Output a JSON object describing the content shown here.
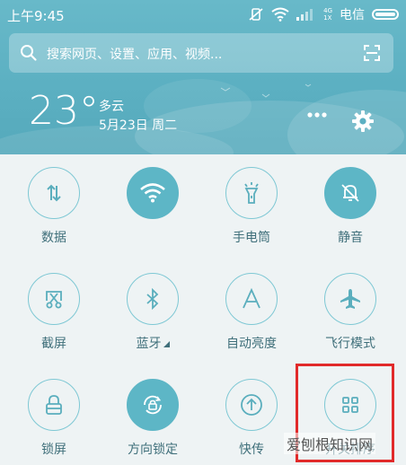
{
  "status_bar": {
    "time": "上午9:45",
    "carrier": "电信",
    "network": "4G",
    "network_sub": "1X"
  },
  "search": {
    "placeholder": "搜索网页、设置、应用、视频..."
  },
  "weather": {
    "temperature": "23°",
    "condition": "多云",
    "date": "5月23日 周二"
  },
  "colors": {
    "accent": "#5db6c6",
    "header": "#5cb0c2",
    "highlight": "#e12a2a"
  },
  "tiles": [
    {
      "label": "数据",
      "icon": "data-arrows-icon",
      "active": false
    },
    {
      "label": "",
      "icon": "wifi-icon",
      "active": true
    },
    {
      "label": "手电筒",
      "icon": "flashlight-icon",
      "active": false
    },
    {
      "label": "静音",
      "icon": "bell-muted-icon",
      "active": true
    },
    {
      "label": "截屏",
      "icon": "screenshot-scissors-icon",
      "active": false
    },
    {
      "label": "蓝牙",
      "icon": "bluetooth-icon",
      "active": false
    },
    {
      "label": "自动亮度",
      "icon": "auto-brightness-icon",
      "active": false
    },
    {
      "label": "飞行模式",
      "icon": "airplane-icon",
      "active": false
    },
    {
      "label": "锁屏",
      "icon": "lock-icon",
      "active": false
    },
    {
      "label": "方向锁定",
      "icon": "rotation-lock-icon",
      "active": true
    },
    {
      "label": "快传",
      "icon": "upload-icon",
      "active": false
    },
    {
      "label": "开关排序",
      "icon": "grid-sort-icon",
      "active": false
    }
  ],
  "watermark": "爱刨根知识网"
}
